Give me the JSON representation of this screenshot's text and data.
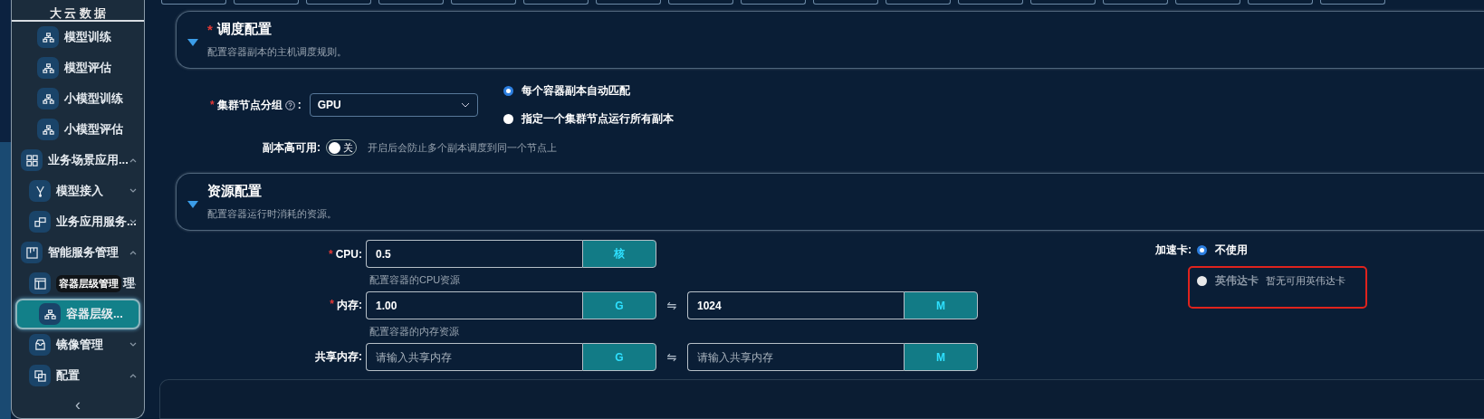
{
  "sidebar": {
    "logo": "大 云 数 据",
    "items": [
      {
        "children": [
          {
            "children": [
              {
                "label": "模型训练",
                "selected": false
              },
              {
                "label": "模型评估",
                "selected": false
              },
              {
                "label": "小模型训练",
                "selected": false
              },
              {
                "label": "小模型评估",
                "selected": false
              }
            ]
          }
        ]
      },
      {
        "label": "业务场景应用...",
        "selected": false,
        "expanded": true,
        "children": [
          {
            "label": "模型接入",
            "selected": false,
            "expanded": false
          },
          {
            "label": "业务应用服务...",
            "selected": false,
            "expanded": false
          }
        ]
      },
      {
        "label": "智能服务管理",
        "selected": false,
        "expanded": true,
        "children": [
          {
            "label": "理",
            "tooltip": "容器层级管理",
            "selected": false,
            "expanded": true,
            "children": [
              {
                "label": "容器层级...",
                "selected": true
              }
            ]
          },
          {
            "label": "镜像管理",
            "selected": false,
            "expanded": false
          },
          {
            "label": "配置",
            "selected": false,
            "expanded": true
          }
        ]
      }
    ],
    "collapse": "‹"
  },
  "sections": [
    {
      "title": "调度配置",
      "required_mark": "*",
      "expanded": true,
      "description": "配置容器副本的主机调度规则。"
    },
    {
      "title": "资源配置",
      "expanded": true,
      "description": "配置容器运行时消耗的资源。"
    }
  ],
  "scheduling": {
    "node_group": {
      "label": "集群节点分组",
      "required_mark": "*",
      "suffix": ":",
      "value": "GPU"
    },
    "placement": [
      {
        "label": "每个容器副本自动匹配",
        "selected": true
      },
      {
        "label": "指定一个集群节点运行所有副本",
        "selected": false
      }
    ],
    "high_availability": {
      "label": "副本高可用:",
      "on": false,
      "state_text": "关",
      "hint": "开启后会防止多个副本调度到同一个节点上"
    }
  },
  "resources": [
    {
      "label": "CPU:",
      "required_mark": "*",
      "value": "0.5",
      "unit": "核",
      "hint": "配置容器的CPU资源"
    },
    {
      "label": "内存:",
      "required_mark": "*",
      "value": "1.00",
      "unit": "G",
      "swap": "⇋",
      "value2": "1024",
      "unit2": "M",
      "hint": "配置容器的内存资源"
    },
    {
      "label": "共享内存:",
      "placeholder": "请输入共享内存",
      "unit": "G",
      "swap": "⇋",
      "placeholder2": "请输入共享内存",
      "unit2": "M"
    }
  ],
  "accelerator": {
    "label": "加速卡:",
    "options": [
      {
        "label": "不使用",
        "selected": true,
        "disabled": false,
        "highlighted": false
      },
      {
        "label": "英伟达卡",
        "selected": false,
        "disabled": true,
        "note": "暂无可用英伟达卡",
        "highlighted": true
      }
    ]
  }
}
